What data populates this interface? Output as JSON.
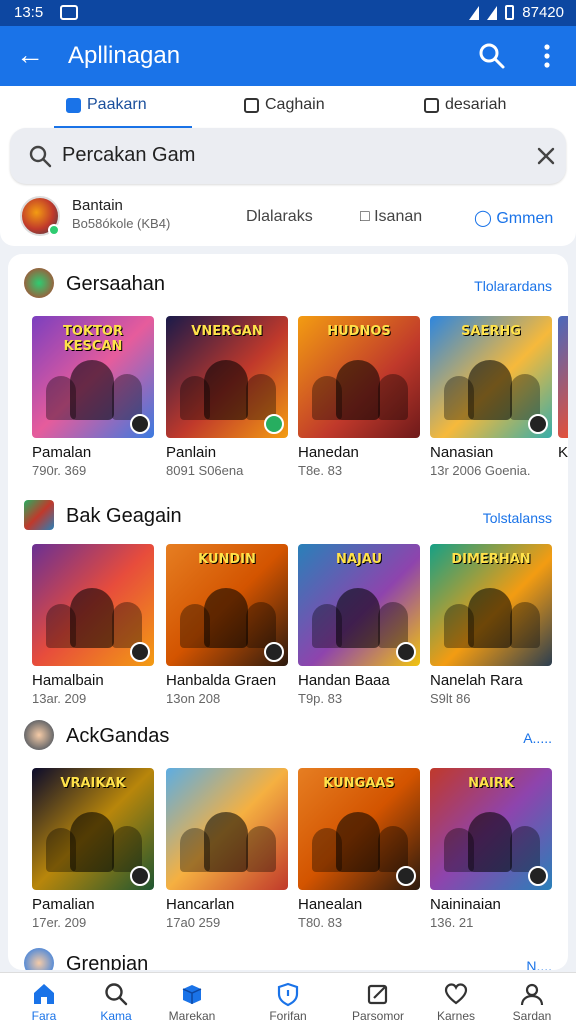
{
  "status_bar": {
    "time": "13:5",
    "right_text": "87420"
  },
  "app_bar": {
    "title": "Apllinagan"
  },
  "tabs": [
    {
      "label": "Paakarn",
      "active": true
    },
    {
      "label": "Caghain",
      "active": false
    },
    {
      "label": "desariah",
      "active": false
    }
  ],
  "search": {
    "value": "Percakan Gam"
  },
  "profile": {
    "name": "Bantain",
    "meta": "Bo58ókole (KB4)",
    "actions": [
      "Dlalaraks",
      "Isanan",
      "Gmmen"
    ]
  },
  "sections": [
    {
      "title": "Gersaahan",
      "more": "Tlolarardans",
      "items": [
        {
          "banner": "TOKTOR KESCAN",
          "title": "Pamalan",
          "meta": "790r. 369"
        },
        {
          "banner": "VNERGAN",
          "title": "Panlain",
          "meta": "8091 S06ena"
        },
        {
          "banner": "HUDNOS",
          "title": "Hanedan",
          "meta": "T8e. 83"
        },
        {
          "banner": "SAERHG",
          "title": "Nanasian",
          "meta": "13r 2006 Goenia."
        },
        {
          "banner": "K",
          "title": "K",
          "meta": ""
        }
      ]
    },
    {
      "title": "Bak Geagain",
      "more": "Tolstalanss",
      "items": [
        {
          "banner": "",
          "title": "Hamalbain",
          "meta": "13ar. 209"
        },
        {
          "banner": "KUNDIN",
          "title": "Hanbalda Graen",
          "meta": "13on 208"
        },
        {
          "banner": "NAJAU",
          "title": "Handan Baaa",
          "meta": "T9p. 83"
        },
        {
          "banner": "DIMERHAN",
          "title": "Nanelah Rara",
          "meta": "S9lt 86"
        }
      ]
    },
    {
      "title": "AckGandas",
      "more": "A.....",
      "items": [
        {
          "banner": "VRAIKAK",
          "title": "Pamalian",
          "meta": "17er. 209"
        },
        {
          "banner": "",
          "title": "Hancarlan",
          "meta": "17a0 259"
        },
        {
          "banner": "KUNGAAS",
          "title": "Hanealan",
          "meta": "T80. 83"
        },
        {
          "banner": "NAIRK",
          "title": "Naininaian",
          "meta": "136. 21"
        }
      ]
    },
    {
      "title": "Grenpian",
      "more": "N....",
      "items": []
    }
  ],
  "bottom_nav": [
    {
      "label": "Fara",
      "icon": "home-icon",
      "active": true
    },
    {
      "label": "Kama",
      "icon": "search-icon",
      "active": false
    },
    {
      "label": "Marekan",
      "icon": "cube-icon",
      "active": false
    },
    {
      "label": "Forifan",
      "icon": "shield-icon",
      "active": false
    },
    {
      "label": "Parsomor",
      "icon": "edit-icon",
      "active": false
    },
    {
      "label": "Karnes",
      "icon": "heart-icon",
      "active": false
    },
    {
      "label": "Sardan",
      "icon": "person-icon",
      "active": false
    }
  ]
}
